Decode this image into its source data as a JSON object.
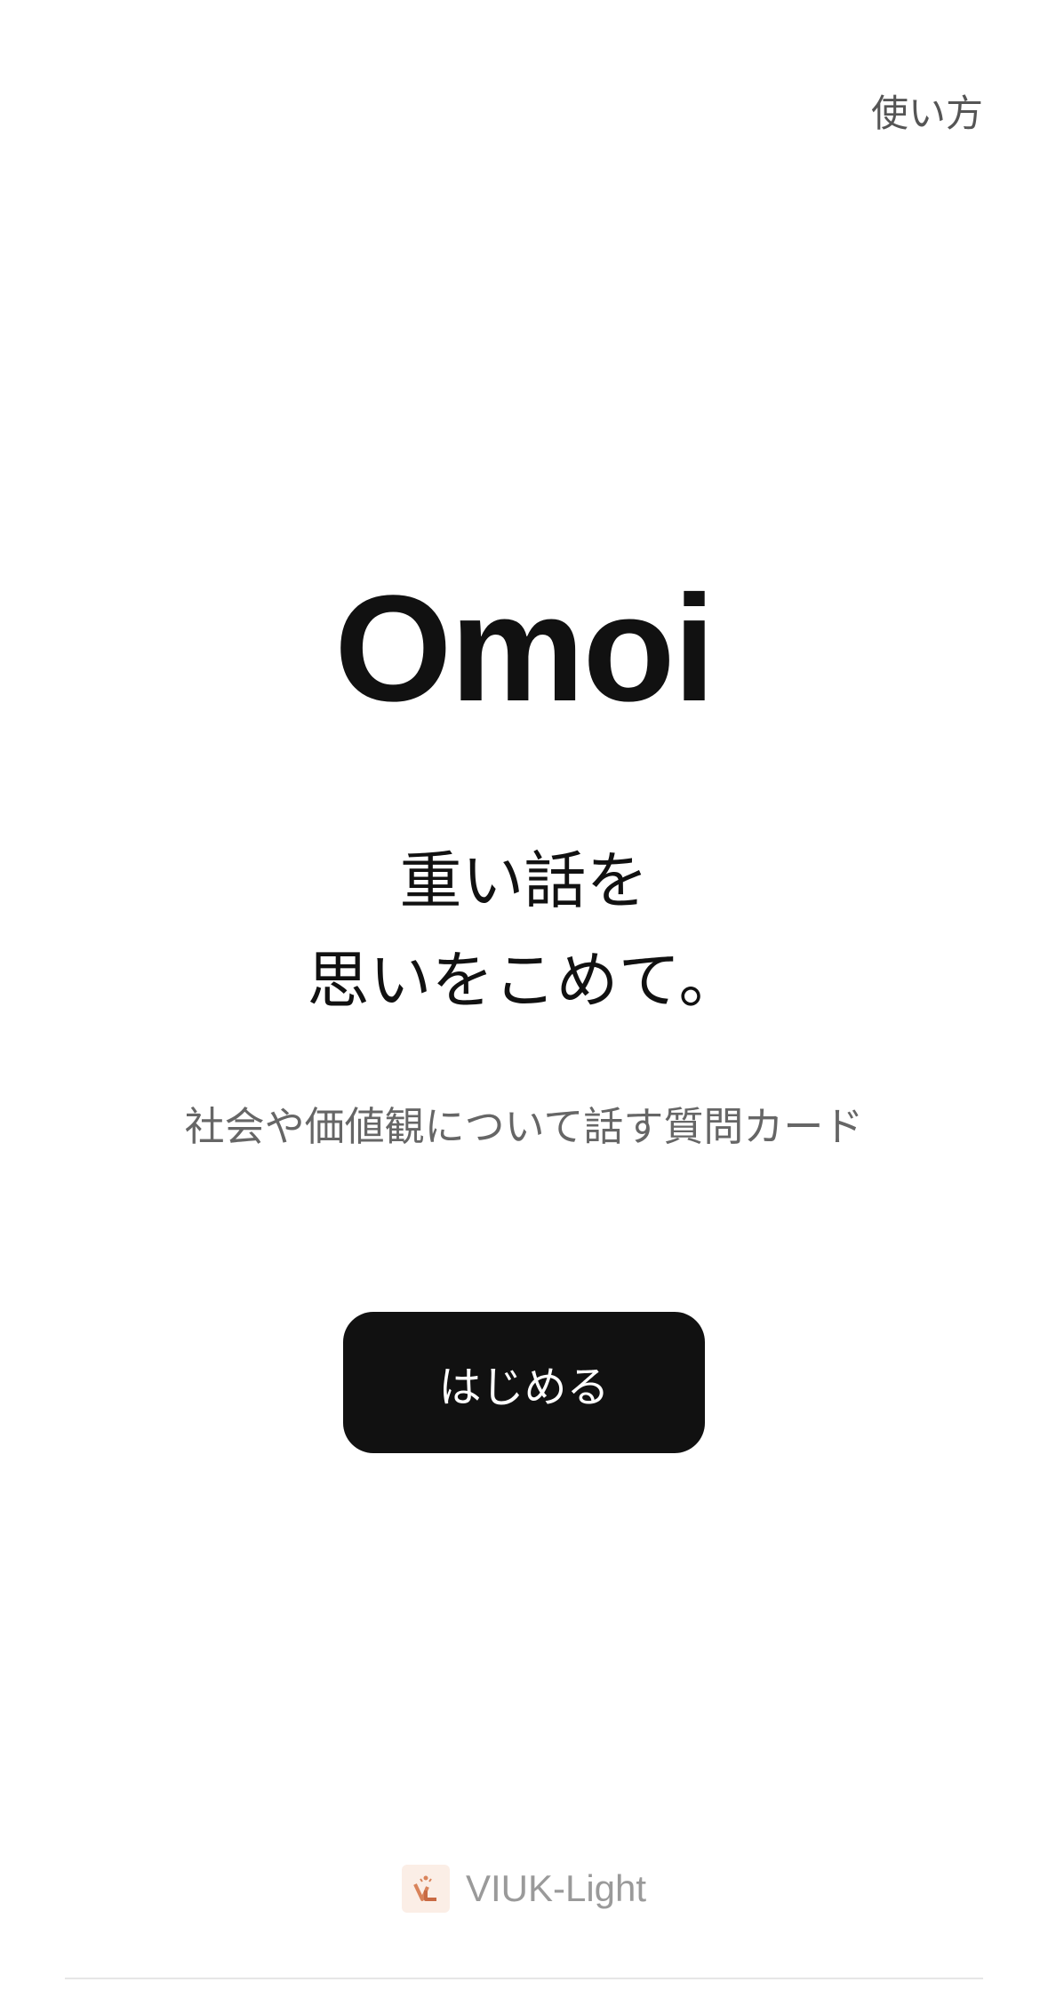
{
  "header": {
    "help_label": "使い方"
  },
  "hero": {
    "title": "Omoi",
    "tagline_line1": "重い話を",
    "tagline_line2": "思いをこめて。",
    "subtitle": "社会や価値観について話す質問カード"
  },
  "actions": {
    "start_label": "はじめる"
  },
  "footer": {
    "brand_name": "VIUK-Light",
    "logo_icon": "viuk-logo-icon"
  },
  "colors": {
    "background": "#ffffff",
    "primary_text": "#111111",
    "secondary_text": "#666666",
    "button_bg": "#111111",
    "button_text": "#ffffff",
    "logo_accent": "#d9835a"
  }
}
